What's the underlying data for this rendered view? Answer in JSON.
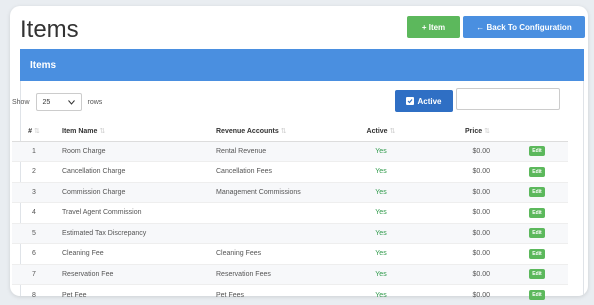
{
  "header": {
    "title": "Items",
    "add_item_label": "+ Item",
    "back_label": "← Back To Configuration"
  },
  "panel": {
    "title": "Items"
  },
  "controls": {
    "show_label": "Show",
    "page_size": "25",
    "rows_label": "rows",
    "active_label": "Active",
    "search_value": ""
  },
  "table": {
    "columns": [
      "#",
      "Item Name",
      "Revenue Accounts",
      "Active",
      "Price",
      ""
    ],
    "rows": [
      {
        "num": "1",
        "name": "Room Charge",
        "revenue": "Rental Revenue",
        "active": "Yes",
        "price": "$0.00",
        "action": "Edit"
      },
      {
        "num": "2",
        "name": "Cancellation Charge",
        "revenue": "Cancellation Fees",
        "active": "Yes",
        "price": "$0.00",
        "action": "Edit"
      },
      {
        "num": "3",
        "name": "Commission Charge",
        "revenue": "Management Commissions",
        "active": "Yes",
        "price": "$0.00",
        "action": "Edit"
      },
      {
        "num": "4",
        "name": "Travel Agent Commission",
        "revenue": "",
        "active": "Yes",
        "price": "$0.00",
        "action": "Edit"
      },
      {
        "num": "5",
        "name": "Estimated Tax Discrepancy",
        "revenue": "",
        "active": "Yes",
        "price": "$0.00",
        "action": "Edit"
      },
      {
        "num": "6",
        "name": "Cleaning Fee",
        "revenue": "Cleaning Fees",
        "active": "Yes",
        "price": "$0.00",
        "action": "Edit"
      },
      {
        "num": "7",
        "name": "Reservation Fee",
        "revenue": "Reservation Fees",
        "active": "Yes",
        "price": "$0.00",
        "action": "Edit"
      },
      {
        "num": "8",
        "name": "Pet Fee",
        "revenue": "Pet Fees",
        "active": "Yes",
        "price": "$0.00",
        "action": "Edit"
      }
    ]
  },
  "colors": {
    "primary": "#4a8fe0",
    "success": "#5cb85c",
    "active_button": "#2f6fc4",
    "yes_text": "#2e9a4a"
  },
  "icons": {
    "sort": "sort-icon",
    "chevron": "chevron-down-icon",
    "checkbox": "checkbox-checked-icon"
  }
}
